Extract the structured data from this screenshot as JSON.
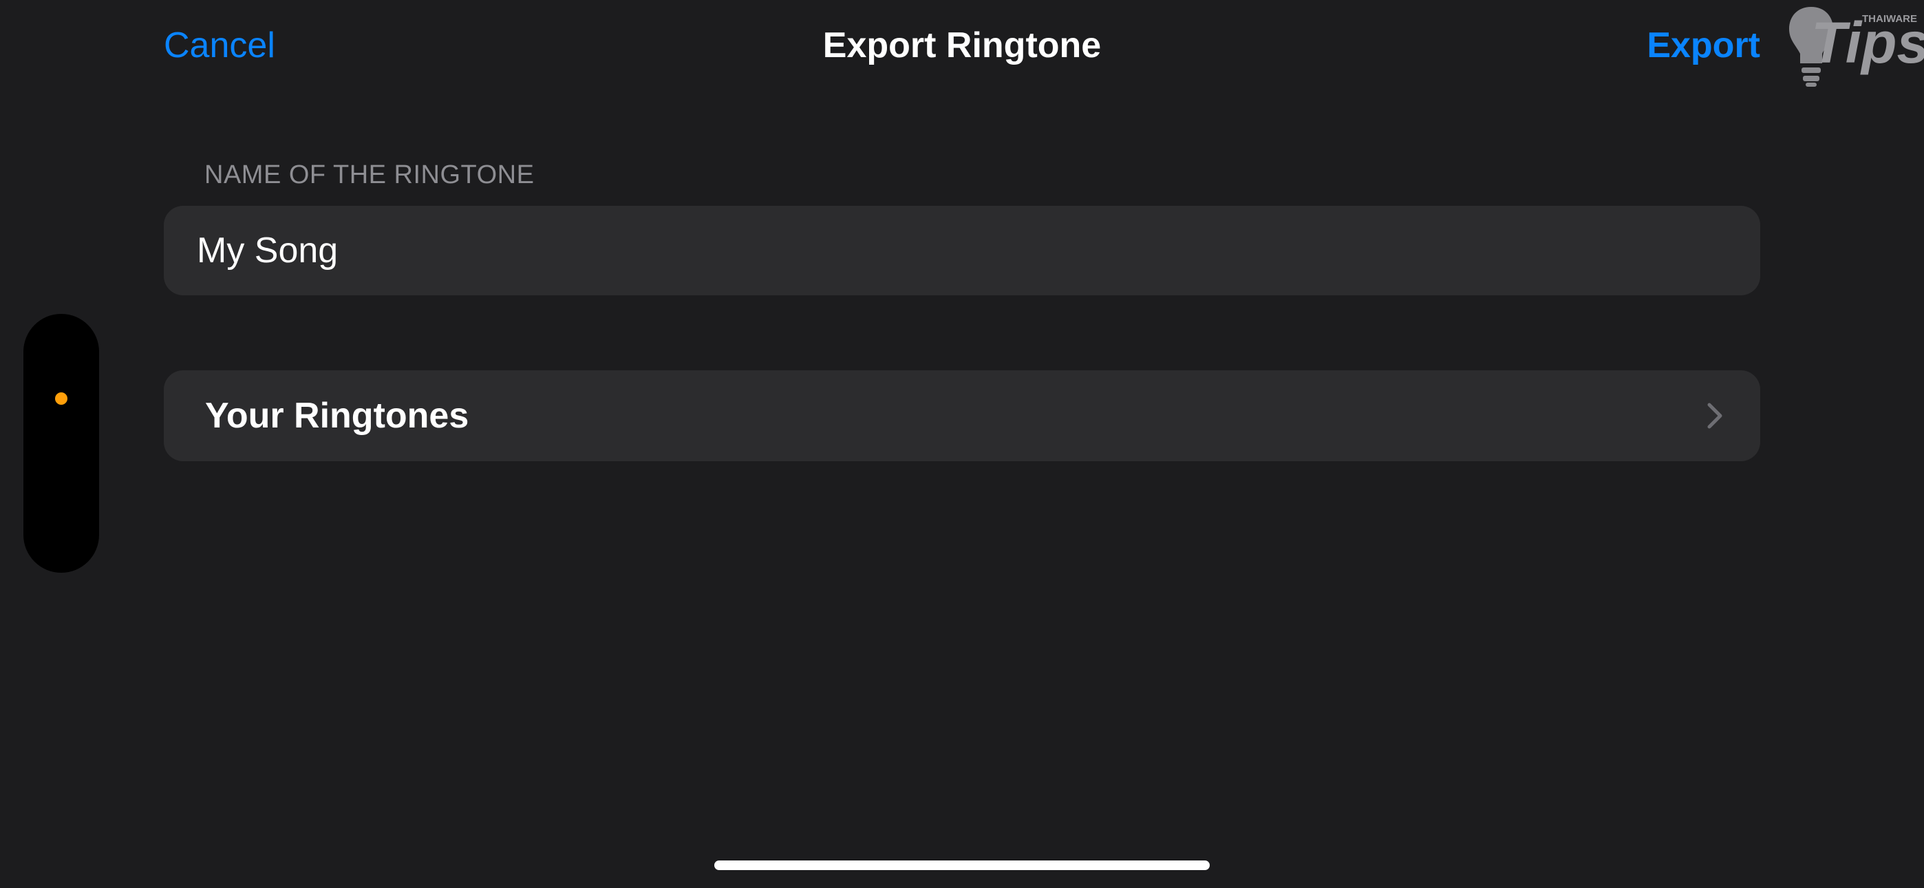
{
  "nav": {
    "cancel_label": "Cancel",
    "title": "Export Ringtone",
    "export_label": "Export"
  },
  "form": {
    "section_header": "NAME OF THE RINGTONE",
    "name_value": "My Song"
  },
  "ringtones": {
    "label": "Your Ringtones",
    "icon": "chevron-right-icon"
  },
  "side_indicator": {
    "dot_color": "#ff9f0a"
  },
  "watermark": {
    "brand": "Tips",
    "brand_small": "THAIWARE"
  },
  "colors": {
    "background": "#1c1c1e",
    "cell": "#2c2c2e",
    "accent": "#0a84ff",
    "secondary_text": "#8e8e93"
  }
}
